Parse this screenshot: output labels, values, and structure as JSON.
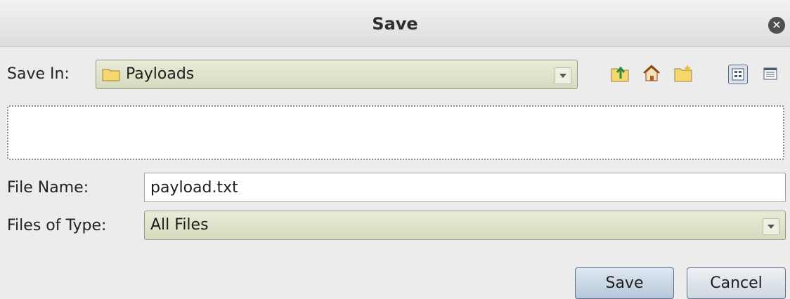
{
  "window": {
    "title": "Save"
  },
  "save_in": {
    "label": "Save In:",
    "value": "Payloads"
  },
  "toolbar": {
    "icons": [
      "up-one-level-icon",
      "home-icon",
      "new-folder-icon",
      "list-view-icon",
      "details-view-icon"
    ]
  },
  "file_name": {
    "label": "File Name:",
    "value": "payload.txt"
  },
  "file_type": {
    "label": "Files of Type:",
    "value": "All Files"
  },
  "buttons": {
    "save": "Save",
    "cancel": "Cancel"
  },
  "colors": {
    "accent": "#b6c7da",
    "combo": "#dde1c8",
    "folder": "#f5d76e"
  }
}
